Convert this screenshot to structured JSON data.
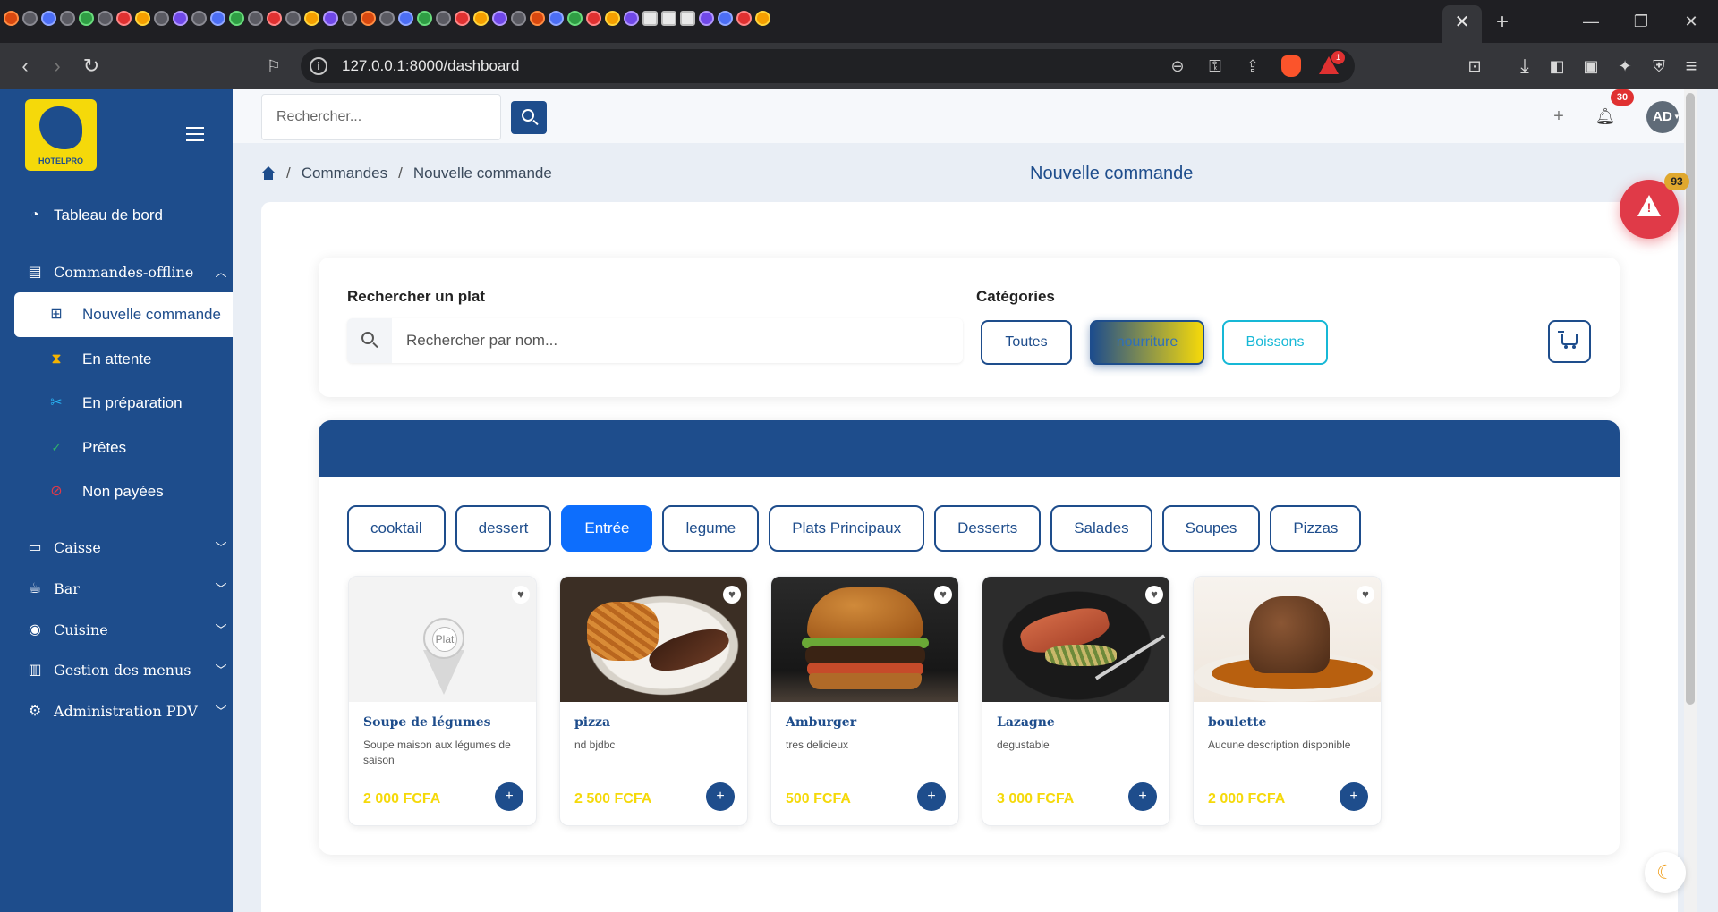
{
  "browser": {
    "url": "127.0.0.1:8000/dashboard",
    "rewards_badge": "1",
    "tab_close": "✕",
    "new_tab": "+"
  },
  "sidebar": {
    "logo_text": "HOTELPRO",
    "items": [
      {
        "label": "Tableau de bord",
        "icon": "dashboard-icon"
      },
      {
        "label": "Commandes-offline",
        "icon": "orders-icon"
      },
      {
        "label": "Caisse",
        "icon": "cash-icon"
      },
      {
        "label": "Bar",
        "icon": "cup-icon"
      },
      {
        "label": "Cuisine",
        "icon": "kitchen-icon"
      },
      {
        "label": "Gestion des menus",
        "icon": "menu-book-icon"
      },
      {
        "label": "Administration PDV",
        "icon": "gear-icon"
      }
    ],
    "sub_items": [
      {
        "label": "Nouvelle commande",
        "icon": "bag-icon",
        "color": "#1e4d8c"
      },
      {
        "label": "En attente",
        "icon": "hourglass-icon",
        "color": "#f5b400"
      },
      {
        "label": "En préparation",
        "icon": "tools-icon",
        "color": "#29b6f6"
      },
      {
        "label": "Prêtes",
        "icon": "check-circle-icon",
        "color": "#2fb36b"
      },
      {
        "label": "Non payées",
        "icon": "unpaid-icon",
        "color": "#e03a48"
      }
    ]
  },
  "header": {
    "search_placeholder": "Rechercher...",
    "notification_count": "30",
    "avatar_initials": "AD"
  },
  "breadcrumb": {
    "items": [
      "Commandes",
      "Nouvelle commande"
    ]
  },
  "page_title": "Nouvelle commande",
  "filters": {
    "search_label": "Rechercher un plat",
    "search_placeholder": "Rechercher par nom...",
    "categories_label": "Catégories",
    "categories": [
      "Toutes",
      "nourriture",
      "Boissons"
    ],
    "selected_category": "nourriture"
  },
  "menu": {
    "subcategories": [
      "cooktail",
      "dessert",
      "Entrée",
      "legume",
      "Plats Principaux",
      "Desserts",
      "Salades",
      "Soupes",
      "Pizzas"
    ],
    "active_subcategory": "Entrée",
    "placeholder_label": "Plat",
    "dishes": [
      {
        "name": "Soupe de légumes",
        "description": "Soupe maison aux légumes de saison",
        "price": "2 000 FCFA",
        "image": "placeholder"
      },
      {
        "name": "pizza",
        "description": "nd bjdbc",
        "price": "2 500 FCFA",
        "image": "steak-fries"
      },
      {
        "name": "Amburger",
        "description": "tres delicieux",
        "price": "500 FCFA",
        "image": "burger"
      },
      {
        "name": "Lazagne",
        "description": "degustable",
        "price": "3 000 FCFA",
        "image": "salmon"
      },
      {
        "name": "boulette",
        "description": "Aucune description disponible",
        "price": "2 000 FCFA",
        "image": "chocolate-fondant"
      }
    ]
  },
  "alerts": {
    "count": "93"
  },
  "colors": {
    "primary": "#1e4d8c",
    "accent": "#f5d90a",
    "active_tab": "#0d6efd",
    "alert": "#e03a48"
  }
}
